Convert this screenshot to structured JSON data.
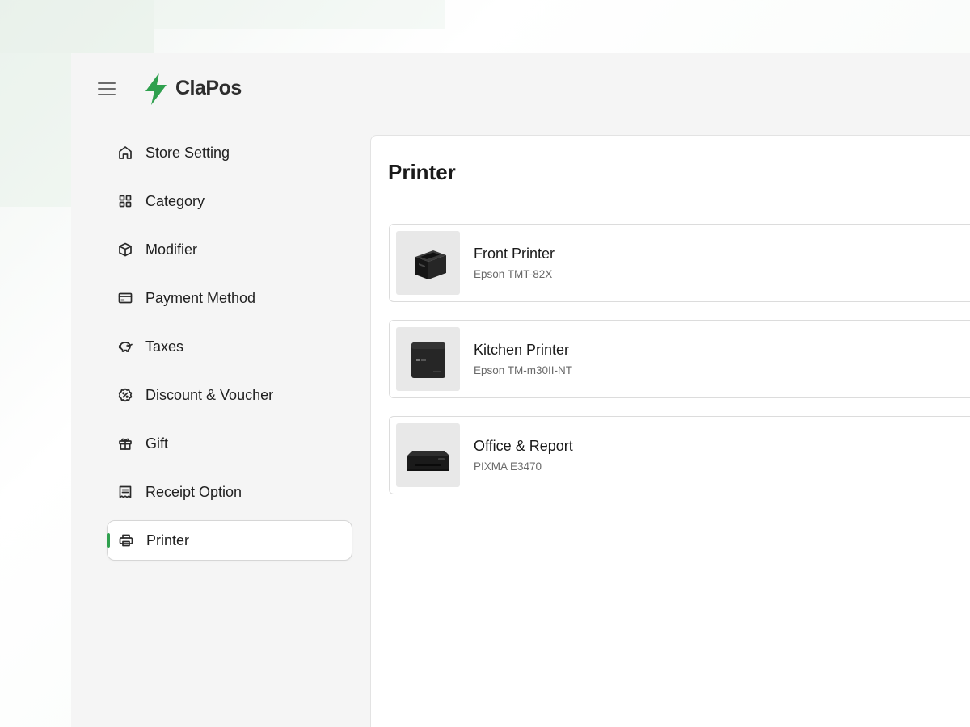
{
  "app": {
    "name": "ClaPos",
    "brand_color": "#2fa04e"
  },
  "header": {
    "menu_icon": "hamburger-icon",
    "logo_icon": "lightning-bolt-icon"
  },
  "sidebar": {
    "active_index": 8,
    "items": [
      {
        "label": "Store Setting",
        "icon": "home-icon"
      },
      {
        "label": "Category",
        "icon": "grid-icon"
      },
      {
        "label": "Modifier",
        "icon": "box-icon"
      },
      {
        "label": "Payment Method",
        "icon": "credit-card-icon"
      },
      {
        "label": "Taxes",
        "icon": "piggy-bank-icon"
      },
      {
        "label": "Discount & Voucher",
        "icon": "discount-badge-icon"
      },
      {
        "label": "Gift",
        "icon": "gift-icon"
      },
      {
        "label": "Receipt Option",
        "icon": "receipt-icon"
      },
      {
        "label": "Printer",
        "icon": "printer-icon"
      }
    ]
  },
  "main": {
    "title": "Printer",
    "printers": [
      {
        "name": "Front Printer",
        "model": "Epson TMT-82X"
      },
      {
        "name": "Kitchen Printer",
        "model": "Epson TM-m30II-NT"
      },
      {
        "name": "Office & Report",
        "model": "PIXMA E3470"
      }
    ]
  }
}
